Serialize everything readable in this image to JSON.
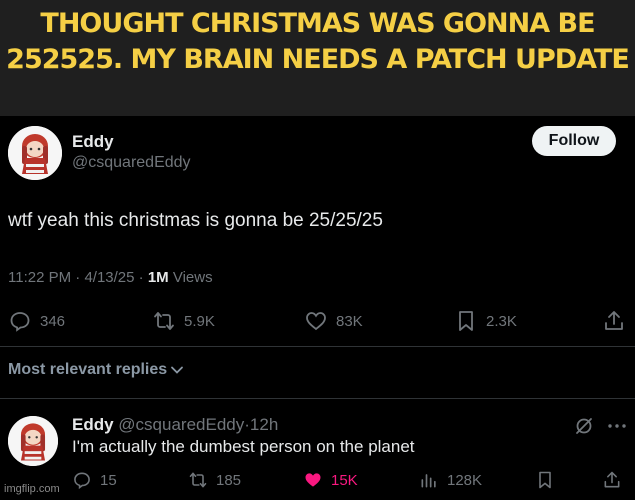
{
  "caption": {
    "line1": "THOUGHT CHRISTMAS WAS GONNA BE",
    "line2": "252525. MY BRAIN NEEDS A PATCH UPDATE"
  },
  "tweet": {
    "author_name": "Eddy",
    "author_handle": "@csquaredEddy",
    "follow_label": "Follow",
    "text": "wtf yeah this christmas is gonna be 25/25/25",
    "time": "11:22 PM",
    "date": "4/13/25",
    "sep": "·",
    "views_count": "1M",
    "views_label": "Views",
    "actions": {
      "replies": "346",
      "reposts": "5.9K",
      "likes": "83K",
      "bookmarks": "2.3K"
    },
    "icons": [
      "reply-icon",
      "repost-icon",
      "like-icon",
      "bookmark-icon",
      "share-icon"
    ]
  },
  "replies_sort_label": "Most relevant replies",
  "reply": {
    "author_name": "Eddy",
    "author_handle": "@csquaredEddy",
    "sep": "·",
    "age": "12h",
    "text": "I'm actually the dumbest person on the planet",
    "actions": {
      "replies": "15",
      "reposts": "185",
      "likes": "15K",
      "views": "128K"
    },
    "like_color": "#f91880"
  },
  "watermark": "imgflip.com"
}
